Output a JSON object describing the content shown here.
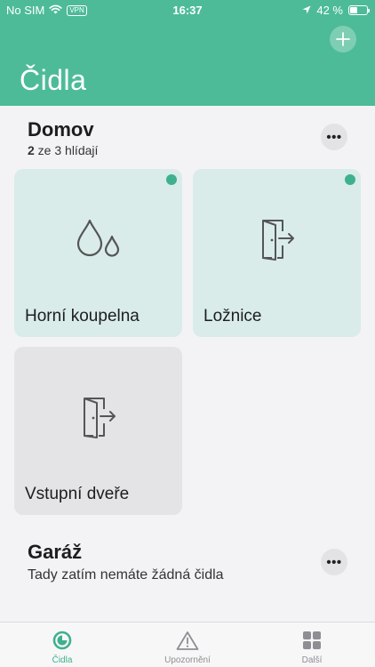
{
  "status_bar": {
    "carrier": "No SIM",
    "vpn": "VPN",
    "time": "16:37",
    "battery": "42 %",
    "battery_level": 0.42
  },
  "header": {
    "title": "Čidla"
  },
  "sections": [
    {
      "title": "Domov",
      "subtitle_count": "2",
      "subtitle_rest": " ze 3 hlídají",
      "more": "•••"
    },
    {
      "title": "Garáž",
      "subtitle": "Tady zatím nemáte žádná čidla",
      "more": "•••"
    }
  ],
  "cards": [
    {
      "label": "Horní koupelna",
      "icon": "water-drops-icon",
      "active": true
    },
    {
      "label": "Ložnice",
      "icon": "door-exit-icon",
      "active": true
    },
    {
      "label": "Vstupní dveře",
      "icon": "door-exit-icon",
      "active": false
    }
  ],
  "tabbar": [
    {
      "label": "Čidla",
      "icon": "sensor-icon",
      "selected": true
    },
    {
      "label": "Upozornění",
      "icon": "warning-icon",
      "selected": false
    },
    {
      "label": "Další",
      "icon": "grid-icon",
      "selected": false
    }
  ],
  "colors": {
    "accent": "#4dbb98",
    "active_card": "#d9ecea",
    "inactive_card": "#e4e4e7",
    "status_dot": "#3fb08d",
    "tab_selected": "#3fb08d",
    "tab_unselected": "#8e8e93"
  }
}
